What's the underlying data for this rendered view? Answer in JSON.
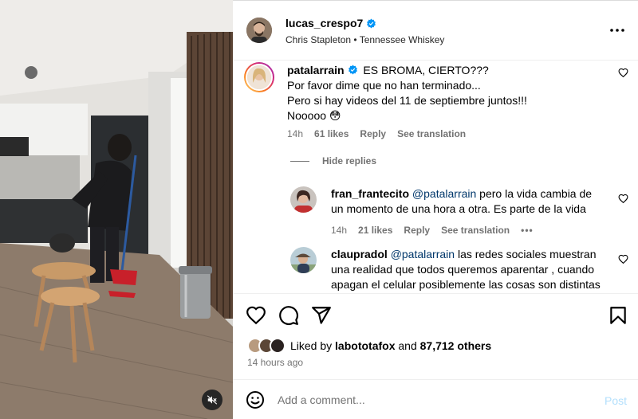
{
  "post": {
    "username": "lucas_crespo7",
    "music": "Chris Stapleton • Tennessee Whiskey"
  },
  "comments": [
    {
      "username": "patalarrain",
      "lines": [
        "ES BROMA, CIERTO???",
        "Por favor dime que no han terminado...",
        "Pero si hay videos del 11 de septiembre juntos!!!",
        "Nooooo 😳"
      ],
      "time": "14h",
      "likes": "61 likes",
      "reply": "Reply",
      "translate": "See translation"
    }
  ],
  "hide_replies": "Hide replies",
  "replies": [
    {
      "username": "fran_frantecito",
      "mention": "@patalarrain",
      "line1_rest": " pero la vida cambia de",
      "line2": "un momento de una hora a otra. Es parte de la vida",
      "time": "14h",
      "likes": "21 likes",
      "reply": "Reply",
      "translate": "See translation",
      "more": "•••"
    },
    {
      "username": "claupradol",
      "mention": "@patalarrain",
      "line1_rest": " las redes sociales muestran",
      "line2": "una realidad que todos queremos aparentar , cuando",
      "line3": "apagan el celular posiblemente las cosas son distintas"
    }
  ],
  "likes": {
    "prefix": "Liked by ",
    "user": "labototafox",
    "middle": " and ",
    "count": "87,712 others"
  },
  "time_ago": "14 hours ago",
  "add_comment": {
    "placeholder": "Add a comment...",
    "post_label": "Post"
  },
  "colors": {
    "link": "#00376b",
    "muted": "#737373",
    "post_disabled": "#b2dffc",
    "verified": "#0095f6"
  },
  "icons": {
    "more": "more-horizontal-icon",
    "heart": "heart-icon",
    "comment": "comment-icon",
    "share": "share-icon",
    "save": "bookmark-icon",
    "emoji": "emoji-icon",
    "mute": "muted-speaker-icon",
    "verified": "verified-badge-icon"
  }
}
